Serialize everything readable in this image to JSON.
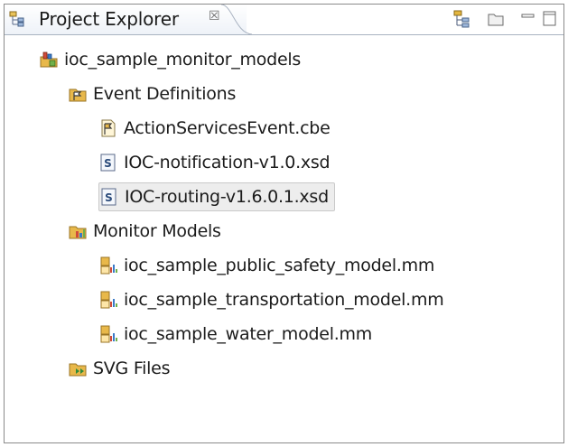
{
  "view": {
    "title": "Project Explorer",
    "close_glyph": "☒",
    "icon": "project-explorer-icon"
  },
  "toolbar": {
    "buttons": [
      {
        "name": "link-with-editor-icon"
      },
      {
        "name": "collapse-all-icon"
      },
      {
        "name": "minimize-icon"
      },
      {
        "name": "maximize-icon"
      }
    ]
  },
  "tree": {
    "project": {
      "label": "ioc_sample_monitor_models",
      "icon": "monitor-project-icon"
    },
    "event_definitions": {
      "label": "Event Definitions",
      "icon": "event-folder-icon",
      "children": [
        {
          "label": "ActionServicesEvent.cbe",
          "icon": "cbe-file-icon"
        },
        {
          "label": "IOC-notification-v1.0.xsd",
          "icon": "xsd-file-icon"
        },
        {
          "label": "IOC-routing-v1.6.0.1.xsd",
          "icon": "xsd-file-icon",
          "selected": true
        }
      ]
    },
    "monitor_models": {
      "label": "Monitor Models",
      "icon": "monitor-folder-icon",
      "children": [
        {
          "label": "ioc_sample_public_safety_model.mm",
          "icon": "mm-file-icon"
        },
        {
          "label": "ioc_sample_transportation_model.mm",
          "icon": "mm-file-icon"
        },
        {
          "label": "ioc_sample_water_model.mm",
          "icon": "mm-file-icon"
        }
      ]
    },
    "svg_files": {
      "label": "SVG Files",
      "icon": "svg-folder-icon"
    }
  },
  "colors": {
    "selection_bg": "#ededed",
    "border": "#8a8a8a",
    "folder": "#e8b84a"
  }
}
